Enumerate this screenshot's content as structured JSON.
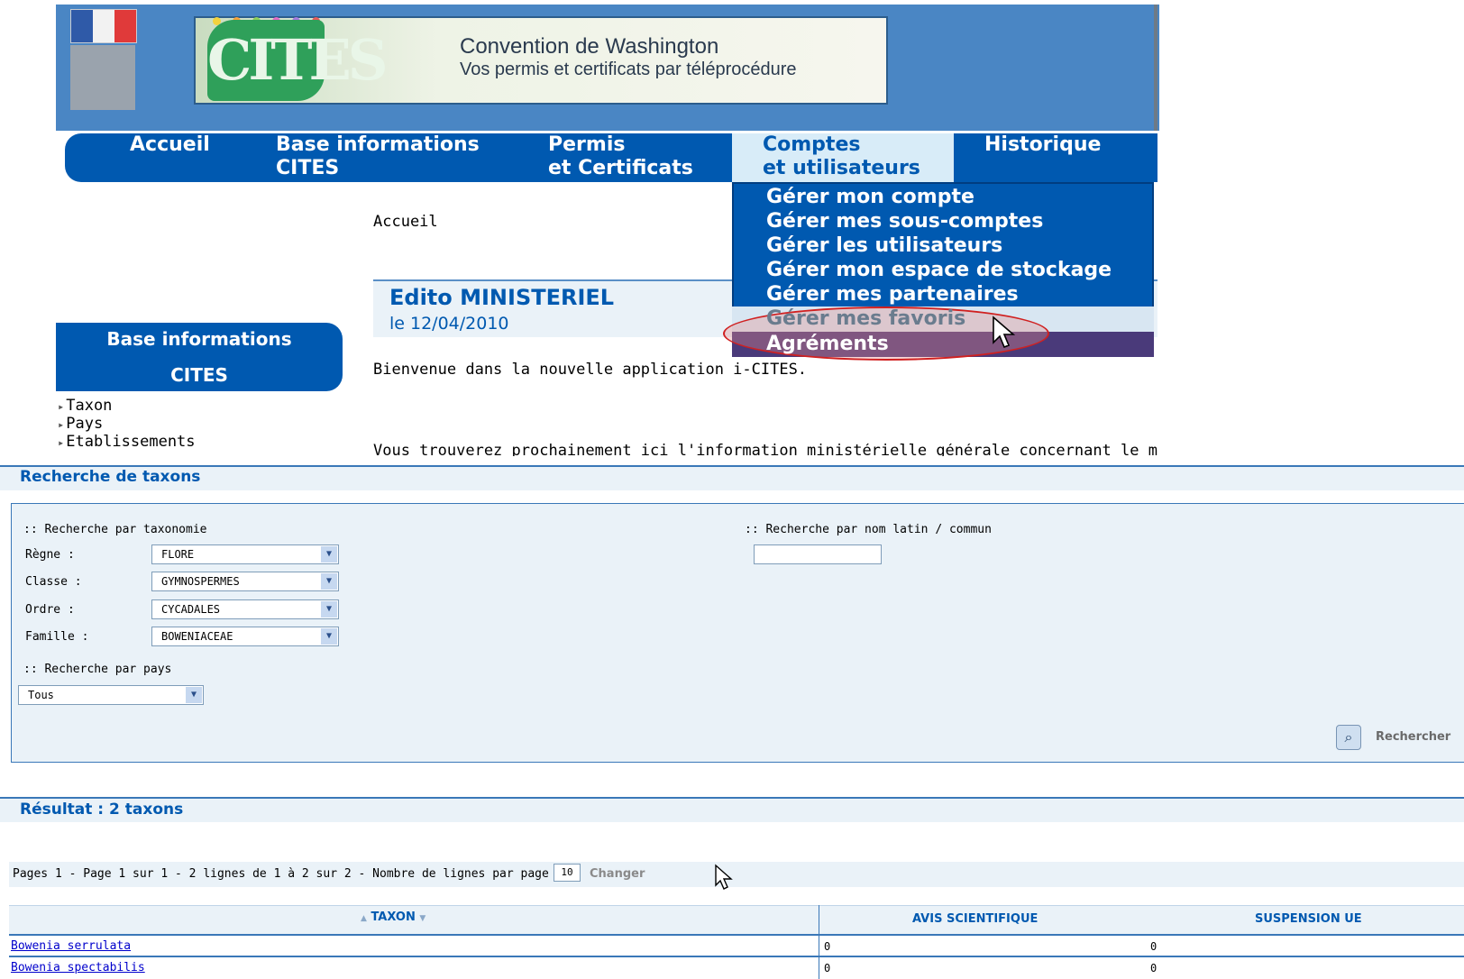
{
  "header": {
    "banner_title": "Convention de Washington",
    "banner_subtitle": "Vos permis et certificats par téléprocédure",
    "logo_text": "CITES",
    "colors": {
      "header_blue": "#4a86c4",
      "nav_blue": "#0059b0",
      "panel_bg": "#eaf2f8"
    }
  },
  "nav": {
    "items": [
      {
        "line1": "Accueil",
        "line2": ""
      },
      {
        "line1": "Base informations",
        "line2": "CITES"
      },
      {
        "line1": "Permis",
        "line2": "et Certificats"
      },
      {
        "line1": "Comptes",
        "line2": "et utilisateurs"
      },
      {
        "line1": "Historique",
        "line2": ""
      }
    ],
    "active_index": 3
  },
  "dropdown": {
    "items": [
      "Gérer mon compte",
      "Gérer mes sous-comptes",
      "Gérer les utilisateurs",
      "Gérer mon espace de stockage",
      "Gérer mes partenaires",
      "Gérer mes favoris",
      "Agréments"
    ]
  },
  "left": {
    "box_line1": "Base informations",
    "box_line2": "CITES",
    "links": [
      "Taxon",
      "Pays",
      "Etablissements"
    ]
  },
  "main": {
    "breadcrumb": "Accueil",
    "edito_title": "Edito MINISTERIEL",
    "edito_date": "le 12/04/2010",
    "welcome": "Bienvenue dans la nouvelle application i-CITES.",
    "info": "Vous trouverez prochainement ici l'information ministérielle générale concernant le métie"
  },
  "search": {
    "title": "Recherche de taxons",
    "taxonomy_label": ":: Recherche par taxonomie",
    "latin_label": ":: Recherche par nom latin / commun",
    "latin_value": "",
    "fields": [
      {
        "label": "Règne :",
        "value": "FLORE"
      },
      {
        "label": "Classe :",
        "value": "GYMNOSPERMES"
      },
      {
        "label": "Ordre :",
        "value": "CYCADALES"
      },
      {
        "label": "Famille :",
        "value": "BOWENIACEAE"
      }
    ],
    "country_label": ":: Recherche par pays",
    "country_value": "Tous",
    "button_label": "Rechercher"
  },
  "results": {
    "title": "Résultat : 2 taxons",
    "pager_text": "Pages  1 - Page 1 sur 1 - 2 lignes de 1 à 2 sur 2 - Nombre de lignes par page :",
    "per_page": "10",
    "change_label": "Changer",
    "columns": [
      "TAXON",
      "AVIS SCIENTIFIQUE",
      "SUSPENSION UE"
    ],
    "rows": [
      {
        "taxon": "Bowenia serrulata",
        "avis": "0",
        "suspension": "0"
      },
      {
        "taxon": "Bowenia spectabilis",
        "avis": "0",
        "suspension": "0"
      }
    ]
  }
}
